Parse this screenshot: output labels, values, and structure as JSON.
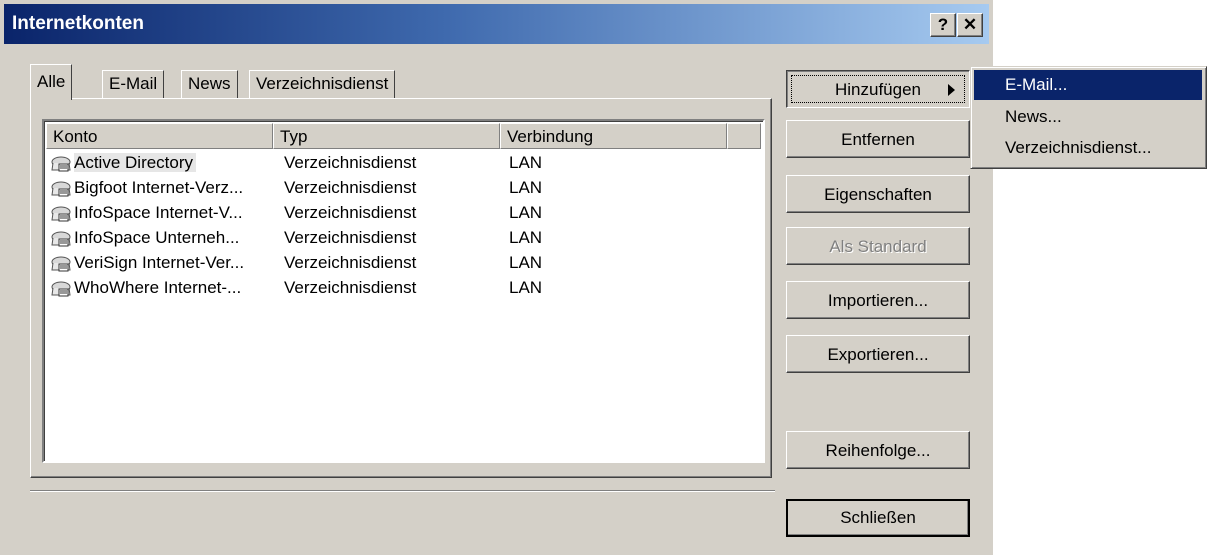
{
  "window": {
    "title": "Internetkonten",
    "help_glyph": "?",
    "close_glyph": "✕"
  },
  "tabs": [
    "Alle",
    "E-Mail",
    "News",
    "Verzeichnisdienst"
  ],
  "list": {
    "columns": [
      "Konto",
      "Typ",
      "Verbindung"
    ],
    "rows": [
      {
        "konto": "Active Directory",
        "typ": "Verzeichnisdienst",
        "verbindung": "LAN"
      },
      {
        "konto": "Bigfoot Internet-Verz...",
        "typ": "Verzeichnisdienst",
        "verbindung": "LAN"
      },
      {
        "konto": "InfoSpace Internet-V...",
        "typ": "Verzeichnisdienst",
        "verbindung": "LAN"
      },
      {
        "konto": "InfoSpace Unterneh...",
        "typ": "Verzeichnisdienst",
        "verbindung": "LAN"
      },
      {
        "konto": "VeriSign Internet-Ver...",
        "typ": "Verzeichnisdienst",
        "verbindung": "LAN"
      },
      {
        "konto": "WhoWhere Internet-...",
        "typ": "Verzeichnisdienst",
        "verbindung": "LAN"
      }
    ],
    "row_icon": "directory-service-icon"
  },
  "buttons": {
    "hinzufuegen": "Hinzufügen",
    "entfernen": "Entfernen",
    "eigenschaften": "Eigenschaften",
    "als_standard": "Als Standard",
    "importieren": "Importieren...",
    "exportieren": "Exportieren...",
    "reihenfolge": "Reihenfolge...",
    "schliessen": "Schließen"
  },
  "add_menu": {
    "items": [
      "E-Mail...",
      "News...",
      "Verzeichnisdienst..."
    ],
    "highlighted": "E-Mail..."
  },
  "colors": {
    "dialog_face": "#d4d0c8",
    "title_start": "#0a246a",
    "title_end": "#a6caf0",
    "menu_highlight": "#0a246a"
  }
}
